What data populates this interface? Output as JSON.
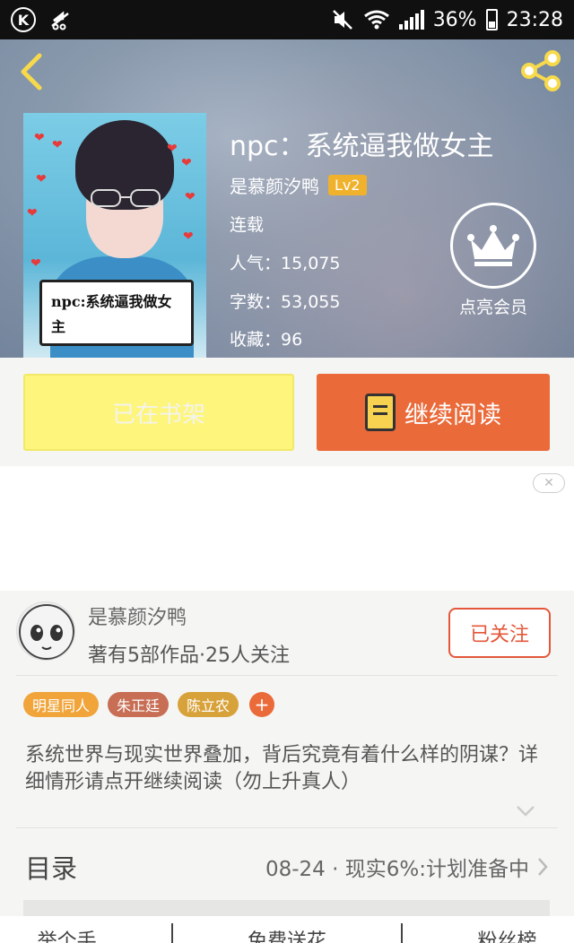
{
  "status_bar": {
    "battery": "36%",
    "time": "23:28",
    "k_letter": "K"
  },
  "book": {
    "title": "npc：系统逼我做女主",
    "author": "是慕颜汐鸭",
    "level": "Lv2",
    "status": "连载",
    "popularity": "人气：15,075",
    "word_count": "字数：53,055",
    "favorites": "收藏：96",
    "cover_text": "npc:系统逼我做女主"
  },
  "vip": {
    "label": "点亮会员"
  },
  "actions": {
    "shelf_label": "已在书架",
    "read_label": "继续阅读"
  },
  "author_card": {
    "name": "是慕颜汐鸭",
    "stats": "著有5部作品·25人关注",
    "follow_label": "已关注"
  },
  "tags": [
    {
      "label": "明星同人",
      "color": "#f0a43a"
    },
    {
      "label": "朱正廷",
      "color": "#c76e55"
    },
    {
      "label": "陈立农",
      "color": "#d8a23a"
    }
  ],
  "tag_add": "+",
  "description": "系统世界与现实世界叠加，背后究竟有着什么样的阴谋？详细情形请点开继续阅读（勿上升真人）",
  "toc": {
    "title": "目录",
    "latest": "08-24 · 现实6%:计划准备中"
  },
  "bottom_tabs": [
    "举个手",
    "免费送花",
    "粉丝榜"
  ],
  "colors": {
    "accent": "#ea6a3a",
    "shelf": "#fdf57c",
    "lv_badge": "#f0b22c"
  }
}
